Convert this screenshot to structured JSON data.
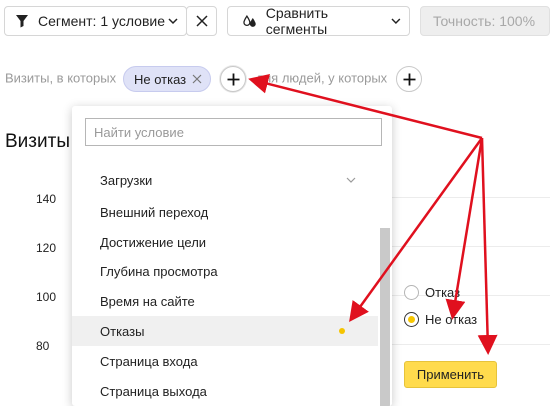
{
  "toolbar": {
    "segment_label": "Сегмент: 1 условие",
    "compare_label": "Сравнить сегменты",
    "accuracy_label": "Точность: 100%"
  },
  "filter": {
    "visits_where": "Визиты, в которых",
    "chip_label": "Не отказ",
    "people_who": "для людей, у которых"
  },
  "chart": {
    "title": "Визиты",
    "y_ticks": [
      "140",
      "120",
      "100",
      "80"
    ]
  },
  "dropdown": {
    "search_placeholder": "Найти условие",
    "items": [
      {
        "label": "Загрузки",
        "expandable": true
      },
      {
        "label": "Внешний переход"
      },
      {
        "label": "Достижение цели"
      },
      {
        "label": "Глубина просмотра"
      },
      {
        "label": "Время на сайте"
      },
      {
        "label": "Отказы",
        "selected": true
      },
      {
        "label": "Страница входа"
      },
      {
        "label": "Страница выхода"
      }
    ]
  },
  "condition_panel": {
    "options": [
      {
        "label": "Отказ",
        "checked": false
      },
      {
        "label": "Не отказ",
        "checked": true
      }
    ],
    "apply_label": "Применить"
  },
  "colors": {
    "accent_yellow": "#ffdb4d",
    "chip_bg": "#dfe2f7",
    "annotation_red": "#e0101e"
  }
}
